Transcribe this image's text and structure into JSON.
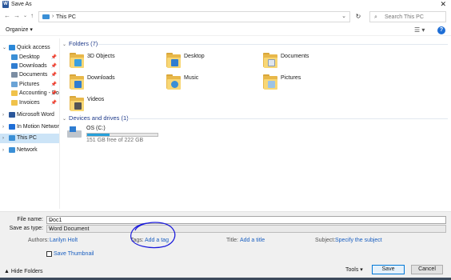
{
  "window": {
    "title": "Save As",
    "app_icon_letter": "W"
  },
  "nav": {
    "back": "←",
    "forward": "→",
    "recent": "⌄",
    "up": "↑",
    "breadcrumb_sep": "›",
    "path": "This PC",
    "dropdown": "⌄",
    "refresh": "↻",
    "search_placeholder": "Search This PC",
    "search_icon": "⌕"
  },
  "toolbar": {
    "organize": "Organize ▾",
    "view_icon": "☰ ▾",
    "help": "?"
  },
  "sidebar": {
    "items": [
      {
        "label": "Quick access",
        "icon": "star-icon",
        "color": "#2b88d8",
        "chevron": "⌄",
        "pin": ""
      },
      {
        "label": "Desktop",
        "icon": "desktop-icon",
        "color": "#3a8fd6",
        "chevron": "",
        "pin": "📌"
      },
      {
        "label": "Downloads",
        "icon": "download-icon",
        "color": "#2f7dd1",
        "chevron": "",
        "pin": "📌"
      },
      {
        "label": "Documents",
        "icon": "documents-icon",
        "color": "#7c8ea3",
        "chevron": "",
        "pin": "📌"
      },
      {
        "label": "Pictures",
        "icon": "pictures-icon",
        "color": "#6aa3d6",
        "chevron": "",
        "pin": "📌"
      },
      {
        "label": "Accounting - Do",
        "icon": "folder-icon",
        "color": "#f0c24b",
        "chevron": "",
        "pin": "📌"
      },
      {
        "label": "Invoices",
        "icon": "folder-icon",
        "color": "#f0c24b",
        "chevron": "",
        "pin": "📌"
      },
      {
        "label": "Microsoft Word",
        "icon": "word-icon",
        "color": "#2b579a",
        "chevron": "›",
        "pin": ""
      },
      {
        "label": "In Motion Networks (",
        "icon": "cloud-icon",
        "color": "#1e6ed6",
        "chevron": "›",
        "pin": ""
      },
      {
        "label": "This PC",
        "icon": "pc-icon",
        "color": "#3a8fd6",
        "chevron": "›",
        "pin": ""
      },
      {
        "label": "Network",
        "icon": "network-icon",
        "color": "#3a8fd6",
        "chevron": "›",
        "pin": ""
      }
    ]
  },
  "folders_group": {
    "title": "Folders (7)",
    "chevron": "⌄"
  },
  "folders": [
    {
      "label": "3D Objects",
      "badge": "#3aa0e0"
    },
    {
      "label": "Desktop",
      "badge": "#2f7dd1"
    },
    {
      "label": "Documents",
      "badge": "#dfe6ee"
    },
    {
      "label": "Downloads",
      "badge": "#2f7dd1"
    },
    {
      "label": "Music",
      "badge": "#3a8fd6"
    },
    {
      "label": "Pictures",
      "badge": "#9cc3e6"
    },
    {
      "label": "Videos",
      "badge": "#555555"
    }
  ],
  "devices_group": {
    "title": "Devices and drives (1)",
    "chevron": "⌄"
  },
  "drive": {
    "name": "OS (C:)",
    "free_text": "151 GB free of 222 GB",
    "used_fraction": 0.32
  },
  "footer": {
    "file_name_label": "File name:",
    "file_name_value": "Doc1",
    "save_type_label": "Save as type:",
    "save_type_value": "Word Document",
    "authors_label": "Authors:",
    "authors_value": "Larilyn Holt",
    "tags_label": "Tags:",
    "tags_value": "Add a tag",
    "title_label": "Title:",
    "title_value": "Add a title",
    "subject_label": "Subject:",
    "subject_value": "Specify the subject",
    "thumbnail_label": "Save Thumbnail",
    "hide_folders": "▲ Hide Folders",
    "tools": "Tools  ▾",
    "save": "Save",
    "cancel": "Cancel"
  }
}
